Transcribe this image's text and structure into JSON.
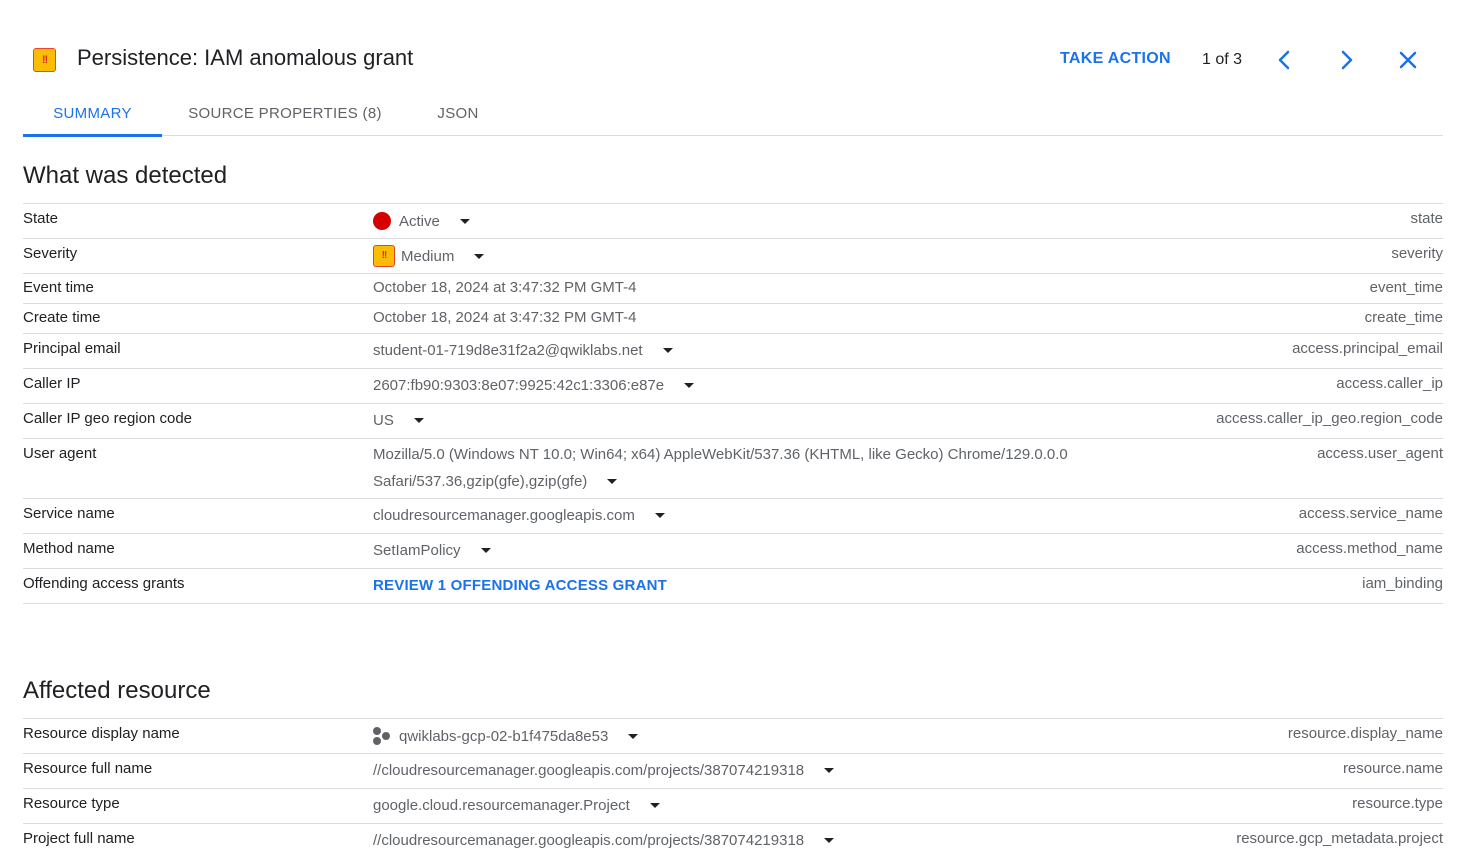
{
  "header": {
    "title": "Persistence: IAM anomalous grant",
    "severity_icon_text": "!!",
    "take_action": "TAKE ACTION",
    "pager": "1 of 3"
  },
  "tabs": [
    {
      "label": "SUMMARY",
      "active": true
    },
    {
      "label": "SOURCE PROPERTIES (8)",
      "active": false
    },
    {
      "label": "JSON",
      "active": false
    }
  ],
  "detected": {
    "title": "What was detected",
    "rows": [
      {
        "label": "State",
        "value": "Active",
        "field": "state"
      },
      {
        "label": "Severity",
        "value": "Medium",
        "field": "severity"
      },
      {
        "label": "Event time",
        "value": "October 18, 2024 at 3:47:32 PM GMT-4",
        "field": "event_time"
      },
      {
        "label": "Create time",
        "value": "October 18, 2024 at 3:47:32 PM GMT-4",
        "field": "create_time"
      },
      {
        "label": "Principal email",
        "value": "student-01-719d8e31f2a2@qwiklabs.net",
        "field": "access.principal_email"
      },
      {
        "label": "Caller IP",
        "value": "2607:fb90:9303:8e07:9925:42c1:3306:e87e",
        "field": "access.caller_ip"
      },
      {
        "label": "Caller IP geo region code",
        "value": "US",
        "field": "access.caller_ip_geo.region_code"
      },
      {
        "label": "User agent",
        "value_line1": "Mozilla/5.0 (Windows NT 10.0; Win64; x64) AppleWebKit/537.36 (KHTML, like Gecko) Chrome/129.0.0.0",
        "value_line2": "Safari/537.36,gzip(gfe),gzip(gfe)",
        "field": "access.user_agent"
      },
      {
        "label": "Service name",
        "value": "cloudresourcemanager.googleapis.com",
        "field": "access.service_name"
      },
      {
        "label": "Method name",
        "value": "SetIamPolicy",
        "field": "access.method_name"
      },
      {
        "label": "Offending access grants",
        "value": "REVIEW 1 OFFENDING ACCESS GRANT",
        "field": "iam_binding"
      }
    ]
  },
  "affected": {
    "title": "Affected resource",
    "rows": [
      {
        "label": "Resource display name",
        "value": "qwiklabs-gcp-02-b1f475da8e53",
        "field": "resource.display_name"
      },
      {
        "label": "Resource full name",
        "value": "//cloudresourcemanager.googleapis.com/projects/387074219318",
        "field": "resource.name"
      },
      {
        "label": "Resource type",
        "value": "google.cloud.resourcemanager.Project",
        "field": "resource.type"
      },
      {
        "label": "Project full name",
        "value": "//cloudresourcemanager.googleapis.com/projects/387074219318",
        "field": "resource.gcp_metadata.project"
      }
    ]
  },
  "colors": {
    "accent": "#1a73e8",
    "active_dot": "#d50000",
    "severity_fill": "#fbbc04",
    "severity_border": "#ea4335"
  },
  "icons": [
    "severity-medium-icon",
    "chevron-left-icon",
    "chevron-right-icon",
    "close-icon",
    "status-dot-icon",
    "dropdown-caret-icon",
    "project-icon"
  ]
}
